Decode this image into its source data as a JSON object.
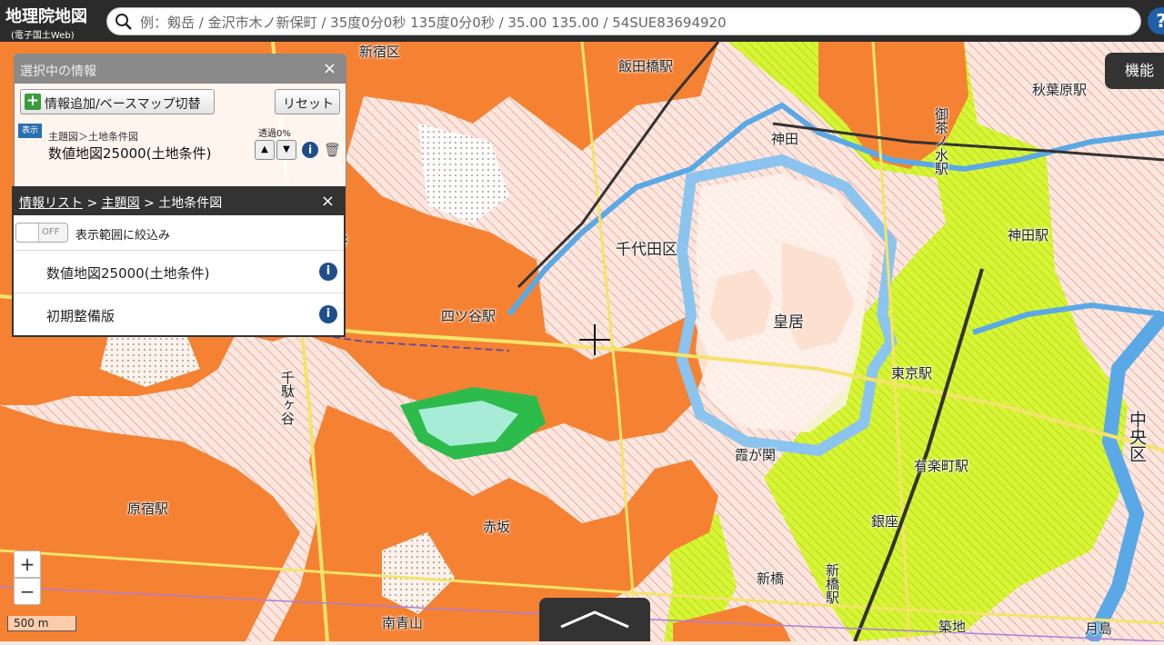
{
  "header": {
    "logo_title": "地理院地図",
    "logo_subtitle": "(電子国土Web)",
    "search_placeholder": "例：剱岳 / 金沢市木ノ新保町 / 35度0分0秒 135度0分0秒 / 35.00 135.00 / 54SUE83694920",
    "help_label": "?"
  },
  "function_button": "機能",
  "selected_panel": {
    "title": "選択中の情報",
    "close": "×",
    "add_button": "情報追加/ベースマップ切替",
    "add_icon": "+",
    "reset_button": "リセット",
    "layer": {
      "badge": "表示",
      "path": "主題図＞土地条件図",
      "name": "数値地図25000(土地条件)",
      "opacity": "透過0%",
      "up": "▲",
      "down": "▼",
      "info": "i",
      "trash": "🗑"
    }
  },
  "list_panel": {
    "breadcrumb": [
      "情報リスト",
      "主題図",
      "土地条件図"
    ],
    "separator": ">",
    "close": "×",
    "toggle": "OFF",
    "filter_label": "表示範囲に絞込み",
    "items": [
      {
        "label": "数値地図25000(土地条件)",
        "info": "i"
      },
      {
        "label": "初期整備版",
        "info": "i"
      }
    ]
  },
  "zoom": {
    "in": "+",
    "out": "−"
  },
  "scale": "500 m",
  "map": {
    "places": {
      "shinjuku_ku": "新宿区",
      "iidabashi": "飯田橋駅",
      "akihabara": "秋葉原駅",
      "kanda_top": "神田",
      "chiyoda_ku": "千代田区",
      "yotsuya_station": "四ツ谷駅",
      "yotsuya": "谷",
      "kokyo": "皇居",
      "tokyo_station": "東京駅",
      "kanda_station": "神田駅",
      "sendagaya": "千駄ヶ谷",
      "shinanomachi": "信濃町",
      "kasumigaseki": "霞が関",
      "yurakucho": "有楽町駅",
      "chuo_ku": "中央区",
      "harajuku": "原宿駅",
      "akasaka": "赤坂",
      "ginza": "銀座",
      "shimbashi": "新橋",
      "shimbashi_station": "新橋駅",
      "minami_aoyama": "南青山",
      "tsukiji": "築地",
      "tsukishima": "月島",
      "ochanomizu": "御茶ノ水駅"
    }
  }
}
